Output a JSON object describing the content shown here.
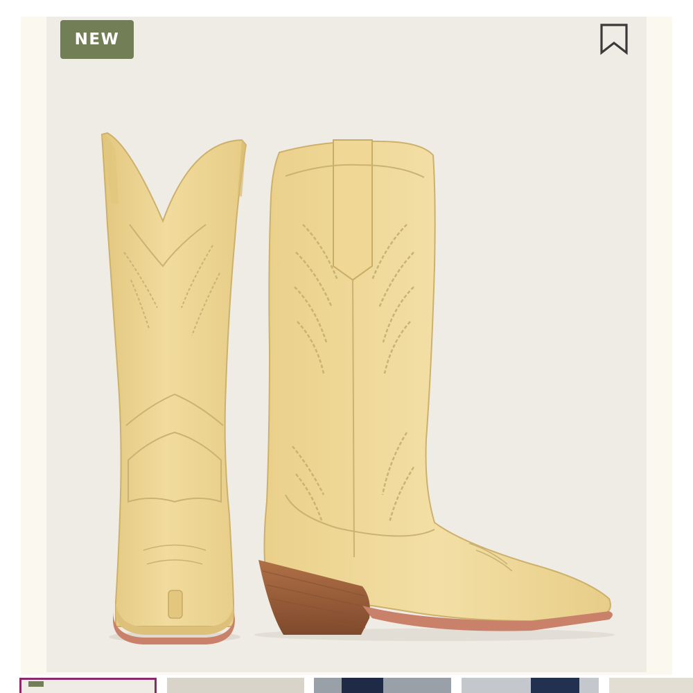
{
  "badge": {
    "label": "NEW"
  },
  "colors": {
    "badge": "#727e55",
    "hero_background": "#efece6",
    "boot_leather": "#efd796",
    "stitching": "#c9b274",
    "heel_wood": "#9a5d3a",
    "sole": "#c9816a",
    "thumb_selected_border": "#8a2a6b"
  },
  "icons": {
    "save": "bookmark-icon"
  },
  "gallery": {
    "thumbnail_count": 5,
    "selected_index": 0
  }
}
